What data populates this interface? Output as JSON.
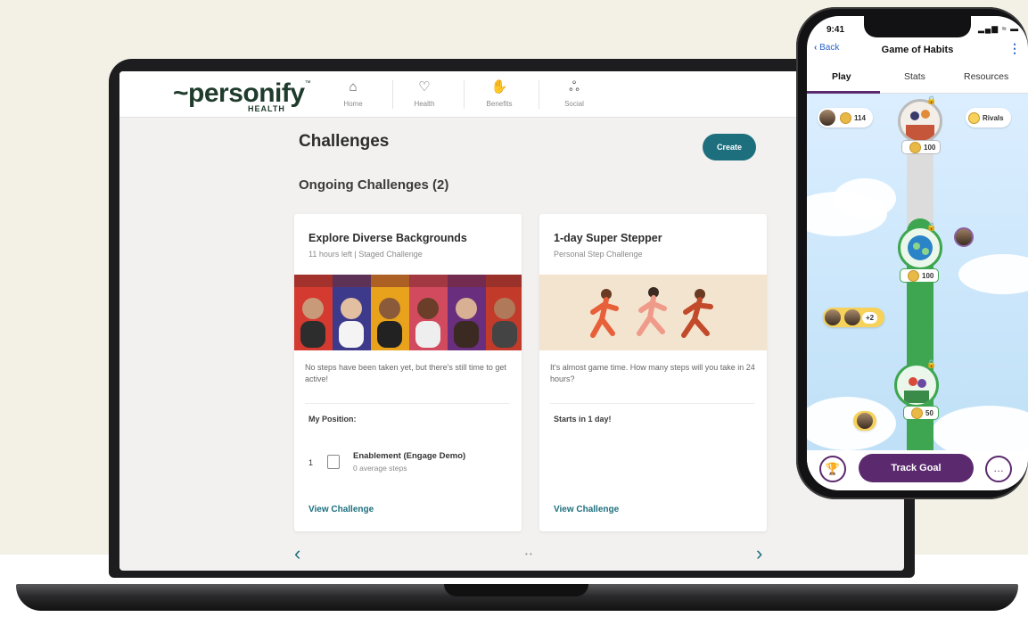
{
  "logo": {
    "word": "~personify",
    "tm": "™",
    "sub": "HEALTH"
  },
  "nav": [
    {
      "label": "Home",
      "icon": "home-icon",
      "glyph": "⌂"
    },
    {
      "label": "Health",
      "icon": "heart-icon",
      "glyph": "♡"
    },
    {
      "label": "Benefits",
      "icon": "hand-heart-icon",
      "glyph": "✋"
    },
    {
      "label": "Social",
      "icon": "people-icon",
      "glyph": "ஃ"
    }
  ],
  "page": {
    "title": "Challenges",
    "create_label": "Create",
    "section_title": "Ongoing Challenges (2)"
  },
  "cards": [
    {
      "title": "Explore Diverse Backgrounds",
      "subtitle": "11 hours left | Staged Challenge",
      "description": "No steps have been taken yet, but there's still time to get active!",
      "section_label": "My Position:",
      "rank": "1",
      "participant": "Enablement (Engage Demo)",
      "participant_steps": "0 average steps",
      "link": "View Challenge"
    },
    {
      "title": "1-day Super Stepper",
      "subtitle": "Personal Step Challenge",
      "description": "It's almost game time. How many steps will you take in 24 hours?",
      "section_label": "Starts in 1 day!",
      "link": "View Challenge"
    }
  ],
  "pager": {
    "prev": "‹",
    "next": "›",
    "dots": "• •"
  },
  "phone": {
    "time": "9:41",
    "status_icons": "▂▄▆ ≈ ▬",
    "back_label": "Back",
    "title": "Game of Habits",
    "menu_glyph": "⋮",
    "tabs": [
      "Play",
      "Stats",
      "Resources"
    ],
    "active_tab": "Play",
    "player_coins": "114",
    "rivals_label": "Rivals",
    "node_coins": [
      "100",
      "100",
      "50"
    ],
    "extra_players": "+2",
    "track_goal_label": "Track Goal",
    "trophy_glyph": "🏆",
    "chat_glyph": "…"
  },
  "colors": {
    "teal": "#1d6f7e",
    "purple": "#5b2a6e",
    "green": "#3ea650",
    "brand": "#1f3b2c"
  }
}
